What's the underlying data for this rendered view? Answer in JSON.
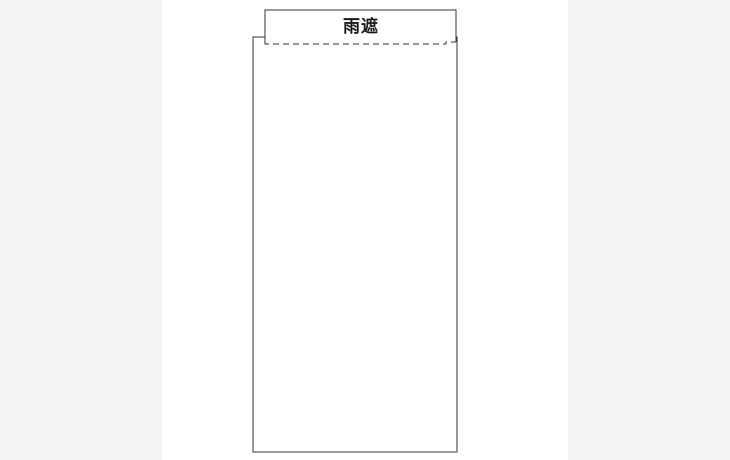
{
  "label": {
    "text": "雨遮"
  },
  "colors": {
    "page_background": "#f3f3f3",
    "sheet": "#ffffff",
    "outline": "#333333",
    "text": "#1a1a1a"
  }
}
